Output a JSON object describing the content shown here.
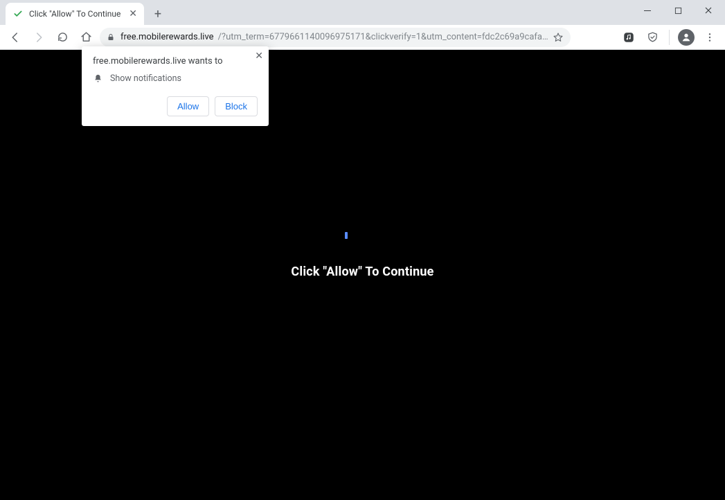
{
  "tab": {
    "title": "Click \"Allow\" To Continue"
  },
  "url": {
    "domain": "free.mobilerewards.live",
    "rest": "/?utm_term=6779661140096975171&clickverify=1&utm_content=fdc2c69a9cafac9f979590a197..."
  },
  "permission": {
    "title": "free.mobilerewards.live wants to",
    "capability": "Show notifications",
    "allow_label": "Allow",
    "block_label": "Block"
  },
  "page": {
    "message": "Click \"Allow\" To Continue"
  }
}
